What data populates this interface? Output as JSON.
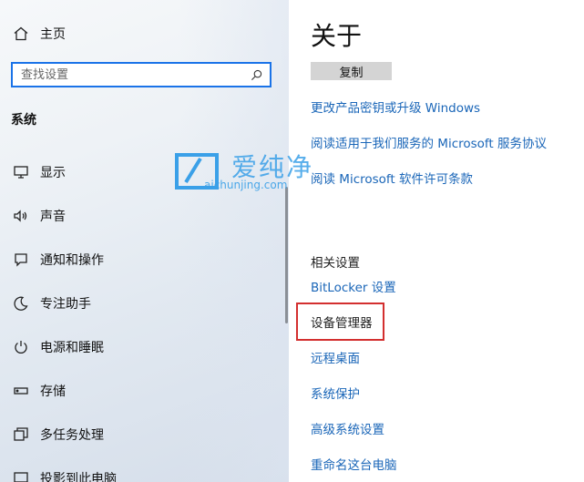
{
  "sidebar": {
    "home_label": "主页",
    "search_placeholder": "查找设置",
    "section_title": "系统",
    "items": [
      {
        "label": "显示",
        "icon": "monitor-icon"
      },
      {
        "label": "声音",
        "icon": "speaker-icon"
      },
      {
        "label": "通知和操作",
        "icon": "notification-icon"
      },
      {
        "label": "专注助手",
        "icon": "moon-icon"
      },
      {
        "label": "电源和睡眠",
        "icon": "power-icon"
      },
      {
        "label": "存储",
        "icon": "storage-icon"
      },
      {
        "label": "多任务处理",
        "icon": "multitask-icon"
      },
      {
        "label": "投影到此电脑",
        "icon": "projection-icon"
      }
    ]
  },
  "main": {
    "title": "关于",
    "copy_button": "复制",
    "links": [
      "更改产品密钥或升级 Windows",
      "阅读适用于我们服务的 Microsoft 服务协议",
      "阅读 Microsoft 软件许可条款"
    ],
    "related_heading": "相关设置",
    "related_links": [
      "BitLocker 设置",
      "设备管理器",
      "远程桌面",
      "系统保护",
      "高级系统设置",
      "重命名这台电脑"
    ]
  },
  "watermark": {
    "cn": "爱纯净",
    "en": "aichunjing.com"
  },
  "colors": {
    "accent": "#1a66b8",
    "search_border": "#1a73e8",
    "highlight": "#d32f2f",
    "watermark": "#3aa0e8"
  }
}
